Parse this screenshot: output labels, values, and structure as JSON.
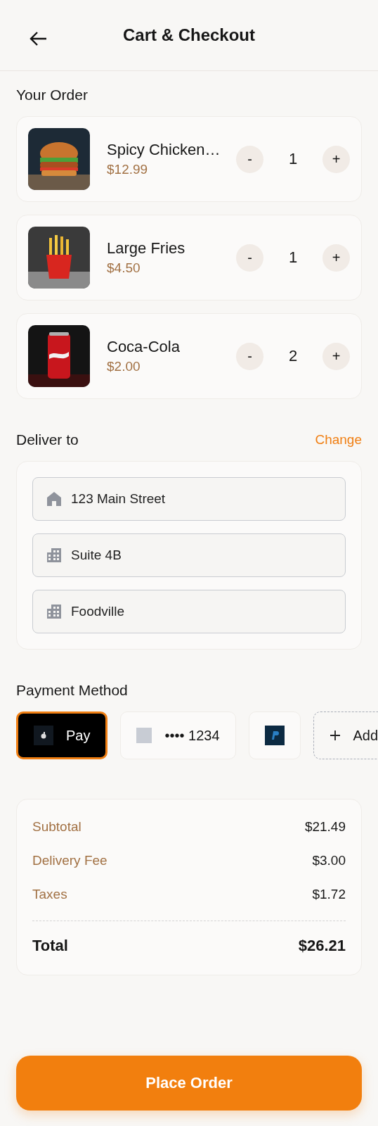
{
  "header": {
    "title": "Cart & Checkout"
  },
  "order": {
    "title": "Your Order",
    "items": [
      {
        "kind": "burger",
        "name": "Spicy Chicken…",
        "price": "$12.99",
        "minus": "-",
        "quantity": "1",
        "plus": "+"
      },
      {
        "kind": "fries",
        "name": "Large Fries",
        "price": "$4.50",
        "minus": "-",
        "quantity": "1",
        "plus": "+"
      },
      {
        "kind": "cola",
        "name": "Coca-Cola",
        "price": "$2.00",
        "minus": "-",
        "quantity": "2",
        "plus": "+"
      }
    ]
  },
  "delivery": {
    "title": "Deliver to",
    "action": "Change",
    "fields": [
      {
        "kind": "home",
        "value": "123 Main Street"
      },
      {
        "kind": "building",
        "value": "Suite 4B"
      },
      {
        "kind": "building",
        "value": "Foodville"
      }
    ]
  },
  "payment": {
    "title": "Payment Method",
    "methods": [
      {
        "kind": "apple",
        "label": "Pay",
        "selected": true
      },
      {
        "kind": "card",
        "label": "•••• 1234",
        "selected": false
      },
      {
        "kind": "paypal",
        "selected": false
      },
      {
        "kind": "add",
        "label": "Add",
        "selected": false
      }
    ]
  },
  "summary": {
    "rows": [
      {
        "label": "Subtotal",
        "value": "$21.49"
      },
      {
        "label": "Delivery Fee",
        "value": "$3.00"
      },
      {
        "label": "Taxes",
        "value": "$1.72"
      }
    ],
    "total": {
      "label": "Total",
      "value": "$26.21"
    }
  },
  "place_order": "Place Order"
}
